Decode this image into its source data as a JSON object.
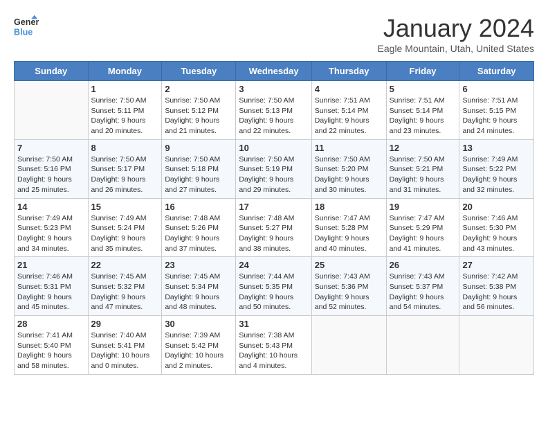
{
  "header": {
    "logo_line1": "General",
    "logo_line2": "Blue",
    "month": "January 2024",
    "location": "Eagle Mountain, Utah, United States"
  },
  "days_of_week": [
    "Sunday",
    "Monday",
    "Tuesday",
    "Wednesday",
    "Thursday",
    "Friday",
    "Saturday"
  ],
  "weeks": [
    [
      {
        "day": "",
        "info": ""
      },
      {
        "day": "1",
        "info": "Sunrise: 7:50 AM\nSunset: 5:11 PM\nDaylight: 9 hours\nand 20 minutes."
      },
      {
        "day": "2",
        "info": "Sunrise: 7:50 AM\nSunset: 5:12 PM\nDaylight: 9 hours\nand 21 minutes."
      },
      {
        "day": "3",
        "info": "Sunrise: 7:50 AM\nSunset: 5:13 PM\nDaylight: 9 hours\nand 22 minutes."
      },
      {
        "day": "4",
        "info": "Sunrise: 7:51 AM\nSunset: 5:14 PM\nDaylight: 9 hours\nand 22 minutes."
      },
      {
        "day": "5",
        "info": "Sunrise: 7:51 AM\nSunset: 5:14 PM\nDaylight: 9 hours\nand 23 minutes."
      },
      {
        "day": "6",
        "info": "Sunrise: 7:51 AM\nSunset: 5:15 PM\nDaylight: 9 hours\nand 24 minutes."
      }
    ],
    [
      {
        "day": "7",
        "info": "Sunrise: 7:50 AM\nSunset: 5:16 PM\nDaylight: 9 hours\nand 25 minutes."
      },
      {
        "day": "8",
        "info": "Sunrise: 7:50 AM\nSunset: 5:17 PM\nDaylight: 9 hours\nand 26 minutes."
      },
      {
        "day": "9",
        "info": "Sunrise: 7:50 AM\nSunset: 5:18 PM\nDaylight: 9 hours\nand 27 minutes."
      },
      {
        "day": "10",
        "info": "Sunrise: 7:50 AM\nSunset: 5:19 PM\nDaylight: 9 hours\nand 29 minutes."
      },
      {
        "day": "11",
        "info": "Sunrise: 7:50 AM\nSunset: 5:20 PM\nDaylight: 9 hours\nand 30 minutes."
      },
      {
        "day": "12",
        "info": "Sunrise: 7:50 AM\nSunset: 5:21 PM\nDaylight: 9 hours\nand 31 minutes."
      },
      {
        "day": "13",
        "info": "Sunrise: 7:49 AM\nSunset: 5:22 PM\nDaylight: 9 hours\nand 32 minutes."
      }
    ],
    [
      {
        "day": "14",
        "info": "Sunrise: 7:49 AM\nSunset: 5:23 PM\nDaylight: 9 hours\nand 34 minutes."
      },
      {
        "day": "15",
        "info": "Sunrise: 7:49 AM\nSunset: 5:24 PM\nDaylight: 9 hours\nand 35 minutes."
      },
      {
        "day": "16",
        "info": "Sunrise: 7:48 AM\nSunset: 5:26 PM\nDaylight: 9 hours\nand 37 minutes."
      },
      {
        "day": "17",
        "info": "Sunrise: 7:48 AM\nSunset: 5:27 PM\nDaylight: 9 hours\nand 38 minutes."
      },
      {
        "day": "18",
        "info": "Sunrise: 7:47 AM\nSunset: 5:28 PM\nDaylight: 9 hours\nand 40 minutes."
      },
      {
        "day": "19",
        "info": "Sunrise: 7:47 AM\nSunset: 5:29 PM\nDaylight: 9 hours\nand 41 minutes."
      },
      {
        "day": "20",
        "info": "Sunrise: 7:46 AM\nSunset: 5:30 PM\nDaylight: 9 hours\nand 43 minutes."
      }
    ],
    [
      {
        "day": "21",
        "info": "Sunrise: 7:46 AM\nSunset: 5:31 PM\nDaylight: 9 hours\nand 45 minutes."
      },
      {
        "day": "22",
        "info": "Sunrise: 7:45 AM\nSunset: 5:32 PM\nDaylight: 9 hours\nand 47 minutes."
      },
      {
        "day": "23",
        "info": "Sunrise: 7:45 AM\nSunset: 5:34 PM\nDaylight: 9 hours\nand 48 minutes."
      },
      {
        "day": "24",
        "info": "Sunrise: 7:44 AM\nSunset: 5:35 PM\nDaylight: 9 hours\nand 50 minutes."
      },
      {
        "day": "25",
        "info": "Sunrise: 7:43 AM\nSunset: 5:36 PM\nDaylight: 9 hours\nand 52 minutes."
      },
      {
        "day": "26",
        "info": "Sunrise: 7:43 AM\nSunset: 5:37 PM\nDaylight: 9 hours\nand 54 minutes."
      },
      {
        "day": "27",
        "info": "Sunrise: 7:42 AM\nSunset: 5:38 PM\nDaylight: 9 hours\nand 56 minutes."
      }
    ],
    [
      {
        "day": "28",
        "info": "Sunrise: 7:41 AM\nSunset: 5:40 PM\nDaylight: 9 hours\nand 58 minutes."
      },
      {
        "day": "29",
        "info": "Sunrise: 7:40 AM\nSunset: 5:41 PM\nDaylight: 10 hours\nand 0 minutes."
      },
      {
        "day": "30",
        "info": "Sunrise: 7:39 AM\nSunset: 5:42 PM\nDaylight: 10 hours\nand 2 minutes."
      },
      {
        "day": "31",
        "info": "Sunrise: 7:38 AM\nSunset: 5:43 PM\nDaylight: 10 hours\nand 4 minutes."
      },
      {
        "day": "",
        "info": ""
      },
      {
        "day": "",
        "info": ""
      },
      {
        "day": "",
        "info": ""
      }
    ]
  ]
}
